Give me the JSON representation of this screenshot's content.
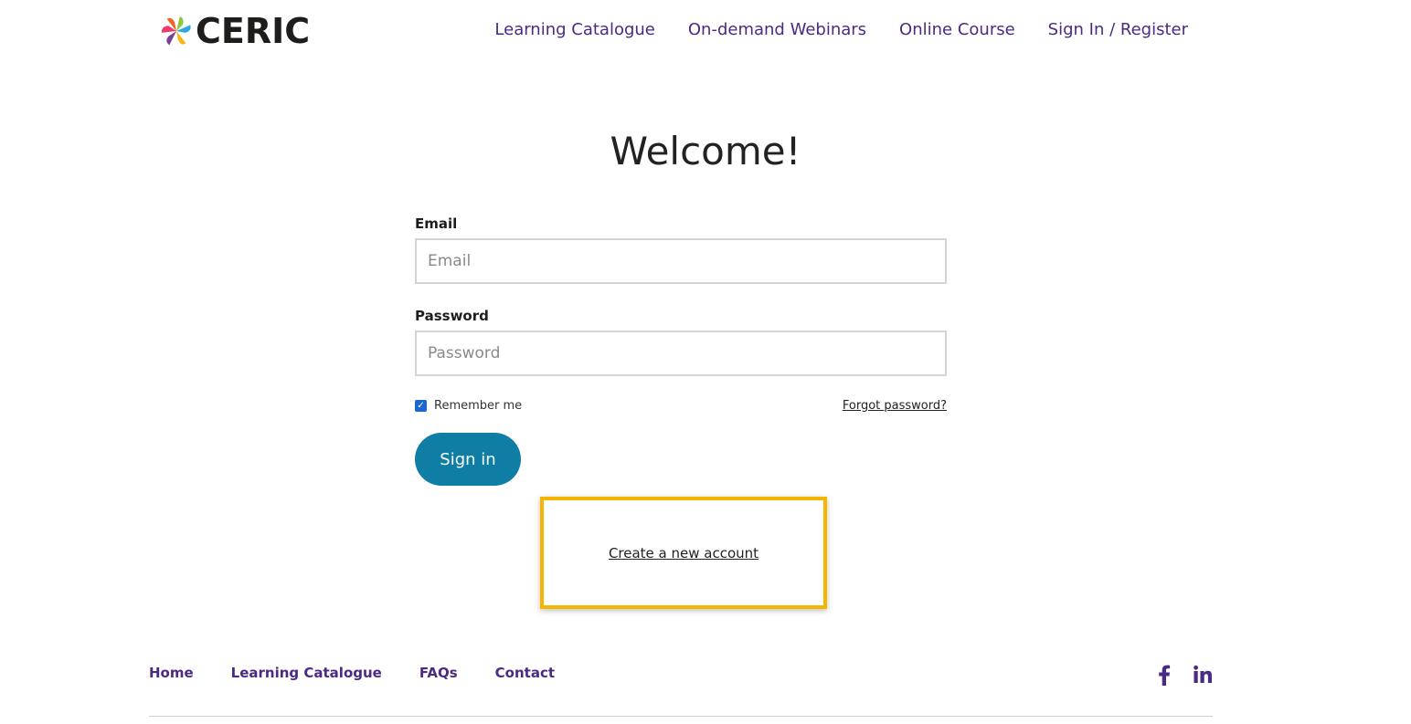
{
  "header": {
    "logo_text": "CERIC",
    "nav": [
      {
        "label": "Learning Catalogue"
      },
      {
        "label": "On-demand Webinars"
      },
      {
        "label": "Online Course"
      },
      {
        "label": "Sign In / Register"
      }
    ]
  },
  "main": {
    "title": "Welcome!",
    "email": {
      "label": "Email",
      "placeholder": "Email",
      "value": ""
    },
    "password": {
      "label": "Password",
      "placeholder": "Password",
      "value": ""
    },
    "remember_me": {
      "label": "Remember me",
      "checked": true
    },
    "forgot_password": "Forgot password?",
    "sign_in_button": "Sign in",
    "create_account": "Create a new account"
  },
  "footer": {
    "nav": [
      {
        "label": "Home"
      },
      {
        "label": "Learning Catalogue"
      },
      {
        "label": "FAQs"
      },
      {
        "label": "Contact"
      }
    ],
    "social": [
      "facebook-icon",
      "linkedin-icon"
    ]
  },
  "colors": {
    "brand_purple": "#4a2a82",
    "button_teal": "#0e7ea4",
    "highlight_yellow": "#f4b400",
    "checkbox_blue": "#1a66d2"
  }
}
